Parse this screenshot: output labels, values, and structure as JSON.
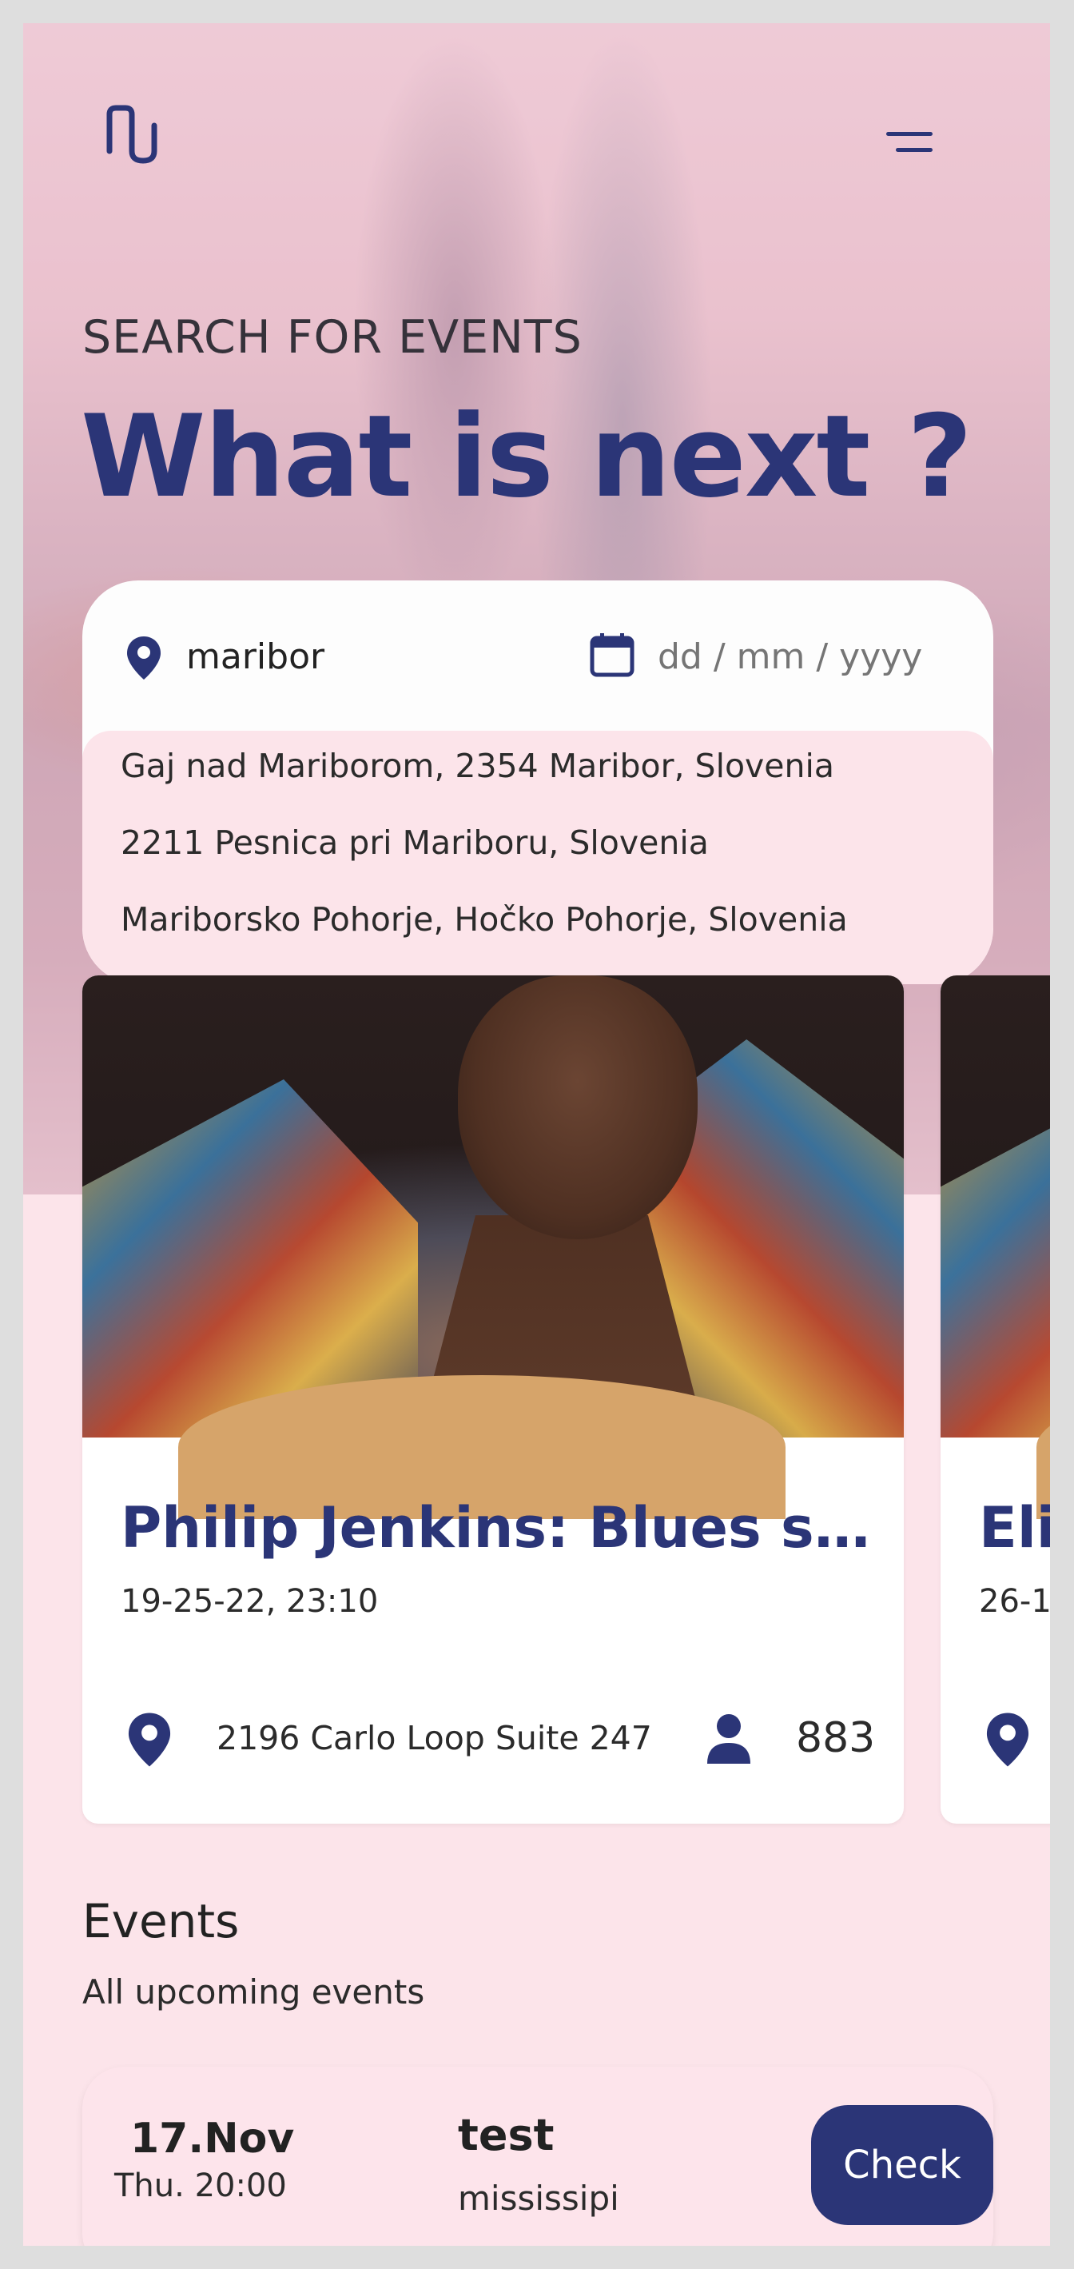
{
  "header": {
    "logo_icon": "nu-logo-icon",
    "menu_icon": "hamburger-menu-icon"
  },
  "hero": {
    "eyebrow": "SEARCH FOR EVENTS",
    "title": "What is next ?"
  },
  "search": {
    "location_icon": "map-pin-icon",
    "location_value": "maribor",
    "date_icon": "calendar-icon",
    "date_placeholder": "dd / mm / yyyy",
    "suggestions": [
      "Gaj nad Mariborom, 2354 Maribor, Slovenia",
      "2211 Pesnica pri Mariboru, Slovenia",
      "Mariborsko Pohorje, Hočko Pohorje, Slovenia"
    ]
  },
  "featured": [
    {
      "title": "Philip Jenkins: Blues sca...",
      "date": "19-25-22, 23:10",
      "address": "2196 Carlo Loop Suite 247",
      "attendees": "883"
    },
    {
      "title": "Eliz",
      "date": "26-1",
      "address": "",
      "attendees": ""
    }
  ],
  "events": {
    "heading": "Events",
    "subheading": "All upcoming events",
    "items": [
      {
        "date": "17.Nov",
        "time": "Thu. 20:00",
        "name": "test",
        "place": "mississipi",
        "action": "Check"
      }
    ]
  },
  "colors": {
    "brand": "#2b3577",
    "page_bg": "#fce4ea",
    "card_bg": "#ffffff"
  }
}
